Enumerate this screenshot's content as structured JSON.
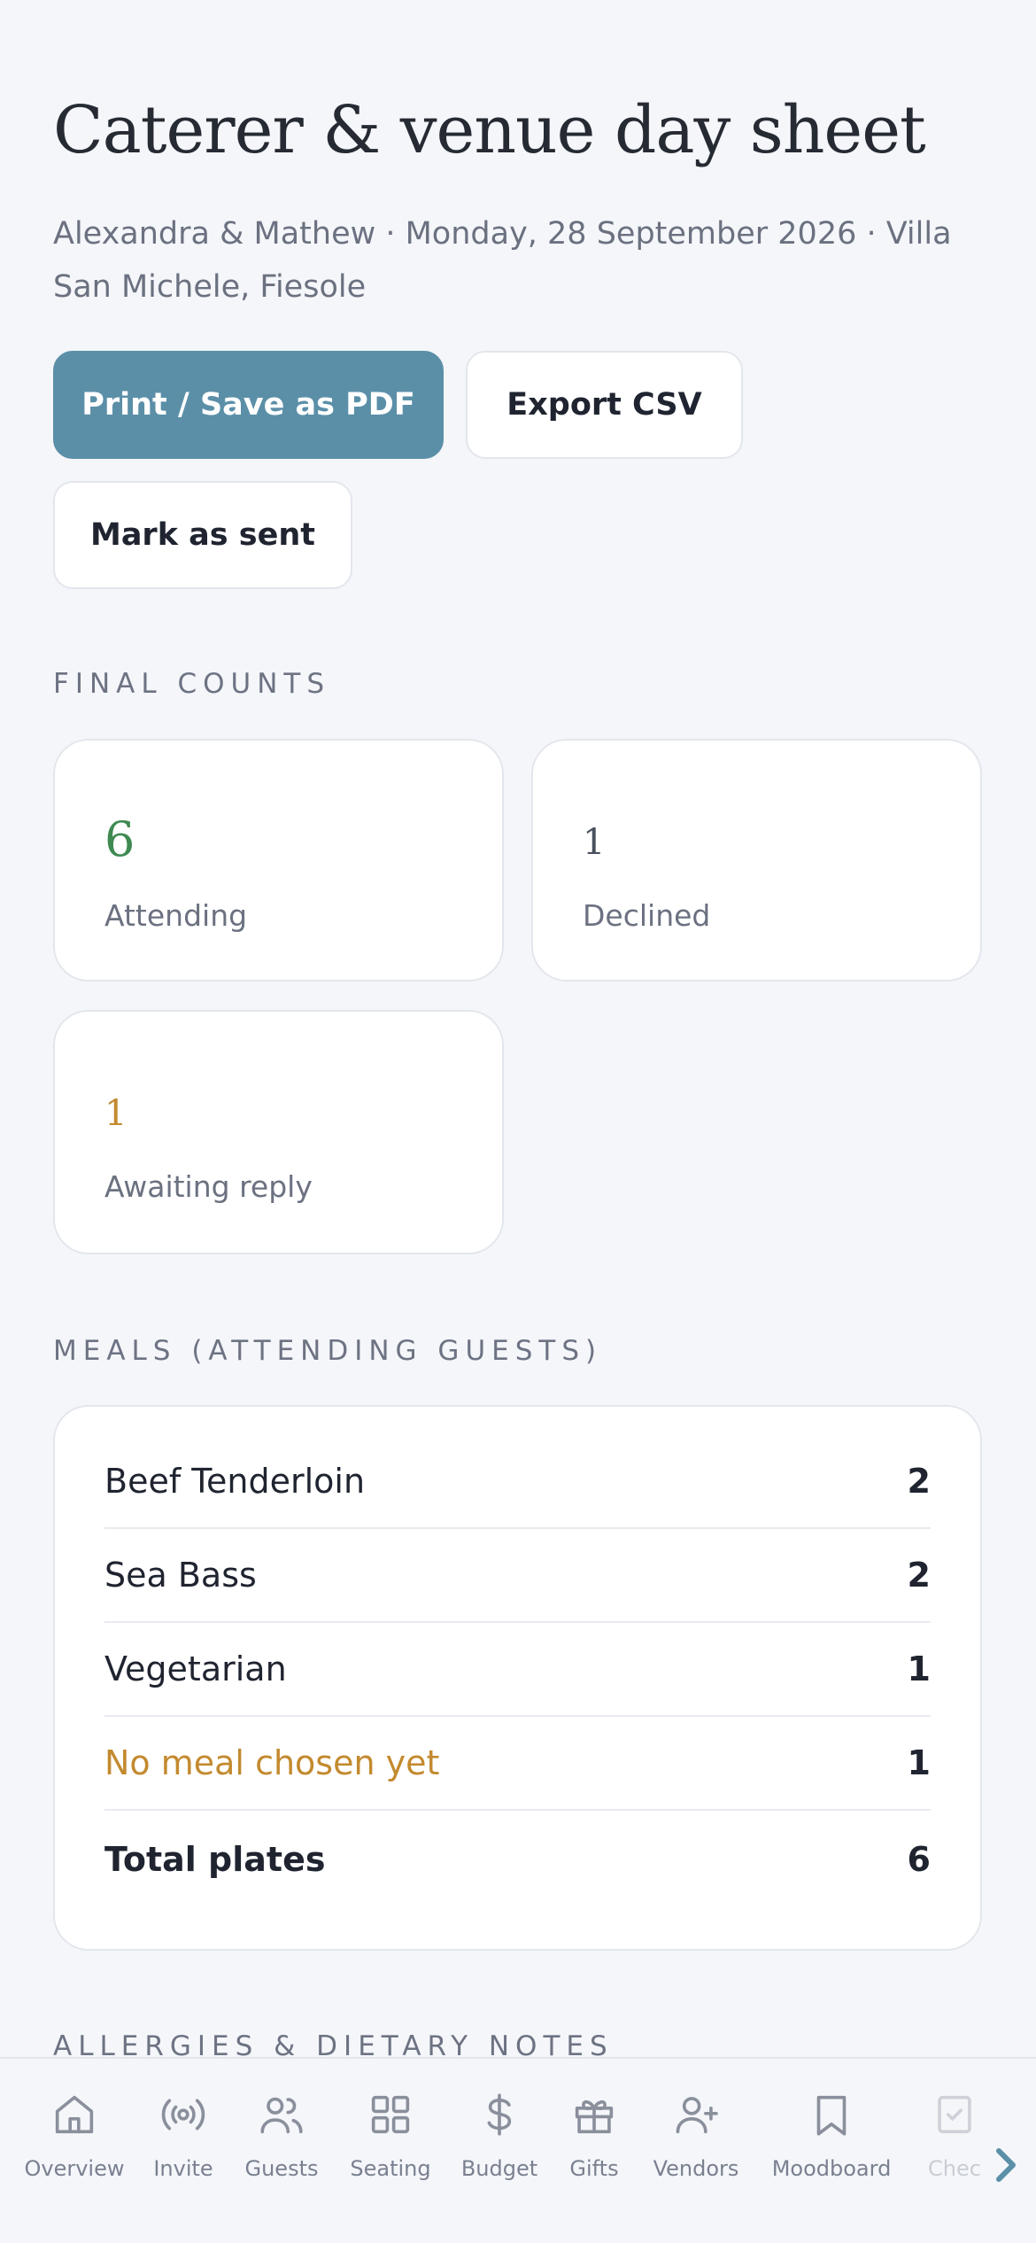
{
  "header": {
    "title": "Caterer & venue day sheet",
    "subtitle": "Alexandra & Mathew · Monday, 28 September 2026 · Villa San Michele, Fiesole"
  },
  "actions": {
    "print_label": "Print / Save as PDF",
    "export_label": "Export CSV",
    "mark_sent_label": "Mark as sent"
  },
  "final_counts": {
    "heading": "FINAL COUNTS",
    "cards": [
      {
        "value": "6",
        "label": "Attending",
        "color": "#3f8a52"
      },
      {
        "value": "1",
        "label": "Declined",
        "color": "#4a505e"
      },
      {
        "value": "1",
        "label": "Awaiting reply",
        "color": "#c38a2f"
      }
    ]
  },
  "meals": {
    "heading": "MEALS (ATTENDING GUESTS)",
    "rows": [
      {
        "name": "Beef Tenderloin",
        "count": "2"
      },
      {
        "name": "Sea Bass",
        "count": "2"
      },
      {
        "name": "Vegetarian",
        "count": "1"
      },
      {
        "name": "No meal chosen yet",
        "count": "1"
      }
    ],
    "total_label": "Total plates",
    "total_value": "6"
  },
  "allergies": {
    "heading": "ALLERGIES & DIETARY NOTES"
  },
  "nav": {
    "items": [
      {
        "label": "Overview",
        "icon": "home-icon"
      },
      {
        "label": "Invite",
        "icon": "broadcast-icon"
      },
      {
        "label": "Guests",
        "icon": "users-icon"
      },
      {
        "label": "Seating",
        "icon": "grid-icon"
      },
      {
        "label": "Budget",
        "icon": "dollar-icon"
      },
      {
        "label": "Gifts",
        "icon": "gift-icon"
      },
      {
        "label": "Vendors",
        "icon": "user-plus-icon"
      },
      {
        "label": "Moodboard",
        "icon": "bookmark-icon"
      },
      {
        "label": "Chec",
        "icon": "checklist-icon"
      }
    ]
  },
  "colors": {
    "accent": "#5b8fa8",
    "attending": "#3f8a52",
    "awaiting": "#c38a2f"
  }
}
